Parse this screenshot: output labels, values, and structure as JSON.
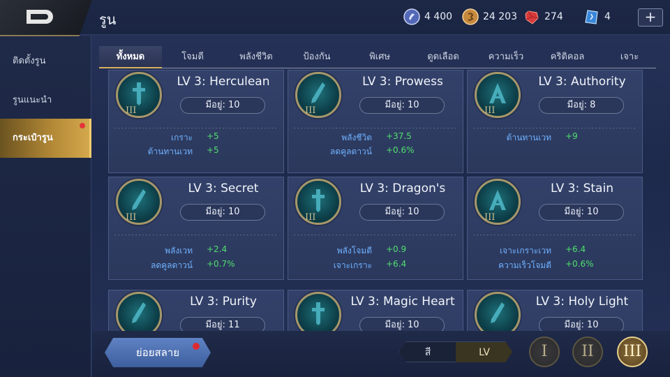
{
  "header": {
    "title": "รูน",
    "currencies": [
      {
        "icon": "blue-voucher-icon",
        "value": "4 400"
      },
      {
        "icon": "gold-coin-icon",
        "value": "24 203"
      },
      {
        "icon": "red-gem-icon",
        "value": "274"
      },
      {
        "icon": "blue-card-icon",
        "value": "4"
      }
    ],
    "plus_label": "+"
  },
  "sidebar": {
    "items": [
      {
        "label": "ติดตั้งรูน"
      },
      {
        "label": "รูนแนะนำ"
      },
      {
        "label": "กระเป๋ารูน"
      }
    ]
  },
  "tabs": [
    {
      "label": "ทั้งหมด"
    },
    {
      "label": "โจมตี"
    },
    {
      "label": "พลังชีวิต"
    },
    {
      "label": "ป้องกัน"
    },
    {
      "label": "พิเศษ"
    },
    {
      "label": "ดูดเลือด"
    },
    {
      "label": "ความเร็ว"
    },
    {
      "label": "คริติคอล"
    },
    {
      "label": "เจาะ"
    }
  ],
  "runes": [
    {
      "name": "LV 3: Herculean",
      "owned": "มีอยู่: 10",
      "level_roman": "III",
      "icon": "sword-rune-icon",
      "stats": [
        {
          "label": "เกราะ",
          "value": "+5"
        },
        {
          "label": "ต้านทานเวท",
          "value": "+5"
        }
      ]
    },
    {
      "name": "LV 3: Prowess",
      "owned": "มีอยู่: 10",
      "level_roman": "III",
      "icon": "blade-rune-icon",
      "stats": [
        {
          "label": "พลังชีวิต",
          "value": "+37.5"
        },
        {
          "label": "ลดคูลดาวน์",
          "value": "+0.6%"
        }
      ]
    },
    {
      "name": "LV 3: Authority",
      "owned": "มีอยู่: 8",
      "level_roman": "III",
      "icon": "arch-rune-icon",
      "stats": [
        {
          "label": "ต้านทานเวท",
          "value": "+9"
        }
      ]
    },
    {
      "name": "LV 3: Secret",
      "owned": "มีอยู่: 10",
      "level_roman": "III",
      "icon": "blade-rune-icon",
      "stats": [
        {
          "label": "พลังเวท",
          "value": "+2.4"
        },
        {
          "label": "ลดคูลดาวน์",
          "value": "+0.7%"
        }
      ]
    },
    {
      "name": "LV 3: Dragon's",
      "owned": "มีอยู่: 10",
      "level_roman": "III",
      "icon": "sword-rune-icon",
      "stats": [
        {
          "label": "พลังโจมตี",
          "value": "+0.9"
        },
        {
          "label": "เจาะเกราะ",
          "value": "+6.4"
        }
      ]
    },
    {
      "name": "LV 3: Stain",
      "owned": "มีอยู่: 10",
      "level_roman": "III",
      "icon": "arch-rune-icon",
      "stats": [
        {
          "label": "เจาะเกราะเวท",
          "value": "+6.4"
        },
        {
          "label": "ความเร็วโจมตี",
          "value": "+0.6%"
        }
      ]
    },
    {
      "name": "LV 3: Purity",
      "owned": "มีอยู่: 11",
      "level_roman": "III",
      "icon": "blade-rune-icon",
      "stats": []
    },
    {
      "name": "LV 3: Magic Heart",
      "owned": "มีอยู่: 10",
      "level_roman": "III",
      "icon": "sword-rune-icon",
      "stats": []
    },
    {
      "name": "LV 3: Holy Light",
      "owned": "มีอยู่: 10",
      "level_roman": "III",
      "icon": "blade-rune-icon",
      "stats": []
    }
  ],
  "bottom": {
    "decompose_label": "ย่อยสลาย",
    "sort_options": [
      {
        "label": "สี"
      },
      {
        "label": "LV"
      }
    ],
    "level_filters": [
      {
        "label": "I"
      },
      {
        "label": "II"
      },
      {
        "label": "III"
      }
    ]
  },
  "colors": {
    "accent_gold": "#d9b25f",
    "stat_label_blue": "#6fb2ff",
    "stat_value_green": "#4fe06d"
  }
}
